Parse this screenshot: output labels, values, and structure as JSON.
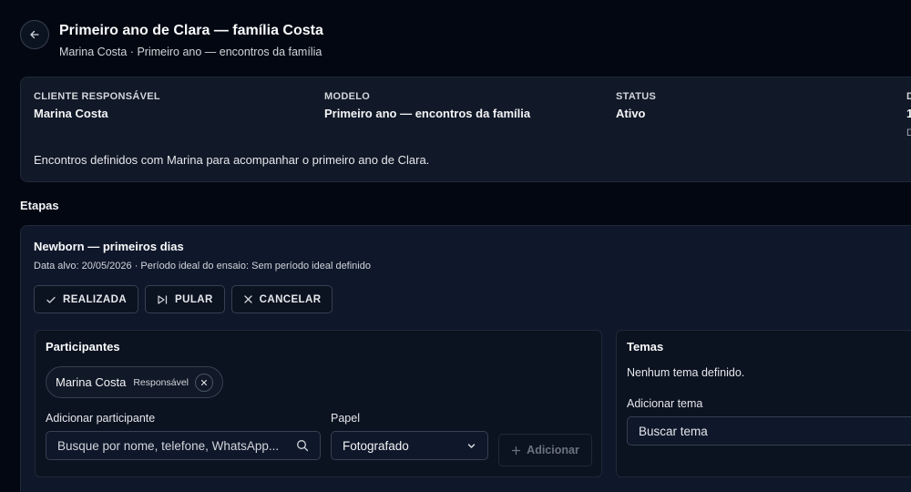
{
  "header": {
    "title": "Primeiro ano de Clara — família Costa",
    "subtitle": "Marina Costa · Primeiro ano — encontros da família"
  },
  "summary": {
    "fields": [
      {
        "label": "CLIENTE RESPONSÁVEL",
        "value": "Marina Costa"
      },
      {
        "label": "MODELO",
        "value": "Primeiro ano — encontros da família"
      },
      {
        "label": "STATUS",
        "value": "Ativo"
      },
      {
        "label": "D",
        "value": "1",
        "extra": "D"
      }
    ],
    "description": "Encontros definidos com Marina para acompanhar o primeiro ano de Clara."
  },
  "stages_title": "Etapas",
  "stage": {
    "title": "Newborn — primeiros dias",
    "meta": "Data alvo: 20/05/2026 · Período ideal do ensaio: Sem período ideal definido",
    "actions": {
      "done": "REALIZADA",
      "skip": "PULAR",
      "cancel": "CANCELAR"
    },
    "participants": {
      "title": "Participantes",
      "chip": {
        "name": "Marina Costa",
        "role": "Responsável"
      },
      "add_label": "Adicionar participante",
      "search_placeholder": "Busque por nome, telefone, WhatsApp...",
      "role_label": "Papel",
      "role_value": "Fotografado",
      "add_button": "Adicionar"
    },
    "themes": {
      "title": "Temas",
      "empty": "Nenhum tema definido.",
      "add_label": "Adicionar tema",
      "search_placeholder": "Buscar tema"
    }
  }
}
